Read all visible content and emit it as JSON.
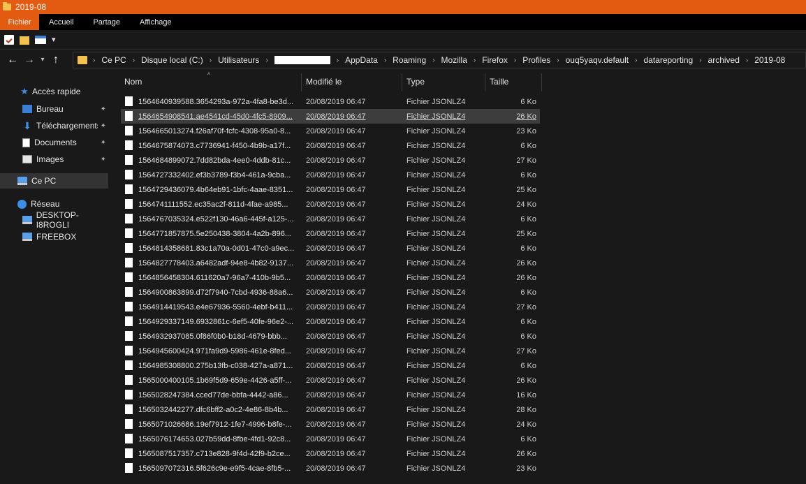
{
  "window": {
    "title": "2019-08"
  },
  "ribbon_tabs": [
    "Fichier",
    "Accueil",
    "Partage",
    "Affichage"
  ],
  "quick_access": {
    "dropdown": "▾"
  },
  "address_bar": {
    "crumbs": [
      "Ce PC",
      "Disque local (C:)",
      "Utilisateurs",
      "AppData",
      "Roaming",
      "Mozilla",
      "Firefox",
      "Profiles",
      "ouq5yaqv.default",
      "datareporting",
      "archived",
      "2019-08"
    ]
  },
  "nav_pane": {
    "quick_access": "Accès rapide",
    "pinned": [
      "Bureau",
      "Téléchargements",
      "Documents",
      "Images"
    ],
    "this_pc": "Ce PC",
    "network": "Réseau",
    "network_items": [
      "DESKTOP-I8ROGLI",
      "FREEBOX"
    ]
  },
  "columns": {
    "name": "Nom",
    "modified": "Modifié le",
    "type": "Type",
    "size": "Taille"
  },
  "files": [
    {
      "name": "1564640939588.3654293a-972a-4fa8-be3d...",
      "date": "20/08/2019 06:47",
      "type": "Fichier JSONLZ4",
      "size": "6 Ko"
    },
    {
      "name": "1564654908541.ae4541cd-45d0-4fc5-8909...",
      "date": "20/08/2019 06:47",
      "type": "Fichier JSONLZ4",
      "size": "26 Ko"
    },
    {
      "name": "1564665013274.f26af70f-fcfc-4308-95a0-8...",
      "date": "20/08/2019 06:47",
      "type": "Fichier JSONLZ4",
      "size": "23 Ko"
    },
    {
      "name": "1564675874073.c7736941-f450-4b9b-a17f...",
      "date": "20/08/2019 06:47",
      "type": "Fichier JSONLZ4",
      "size": "6 Ko"
    },
    {
      "name": "1564684899072.7dd82bda-4ee0-4ddb-81c...",
      "date": "20/08/2019 06:47",
      "type": "Fichier JSONLZ4",
      "size": "27 Ko"
    },
    {
      "name": "1564727332402.ef3b3789-f3b4-461a-9cba...",
      "date": "20/08/2019 06:47",
      "type": "Fichier JSONLZ4",
      "size": "6 Ko"
    },
    {
      "name": "1564729436079.4b64eb91-1bfc-4aae-8351...",
      "date": "20/08/2019 06:47",
      "type": "Fichier JSONLZ4",
      "size": "25 Ko"
    },
    {
      "name": "1564741111552.ec35ac2f-811d-4fae-a985...",
      "date": "20/08/2019 06:47",
      "type": "Fichier JSONLZ4",
      "size": "24 Ko"
    },
    {
      "name": "1564767035324.e522f130-46a6-445f-a125-...",
      "date": "20/08/2019 06:47",
      "type": "Fichier JSONLZ4",
      "size": "6 Ko"
    },
    {
      "name": "1564771857875.5e250438-3804-4a2b-896...",
      "date": "20/08/2019 06:47",
      "type": "Fichier JSONLZ4",
      "size": "25 Ko"
    },
    {
      "name": "1564814358681.83c1a70a-0d01-47c0-a9ec...",
      "date": "20/08/2019 06:47",
      "type": "Fichier JSONLZ4",
      "size": "6 Ko"
    },
    {
      "name": "1564827778403.a6482adf-94e8-4b82-9137...",
      "date": "20/08/2019 06:47",
      "type": "Fichier JSONLZ4",
      "size": "26 Ko"
    },
    {
      "name": "1564856458304.611620a7-96a7-410b-9b5...",
      "date": "20/08/2019 06:47",
      "type": "Fichier JSONLZ4",
      "size": "26 Ko"
    },
    {
      "name": "1564900863899.d72f7940-7cbd-4936-88a6...",
      "date": "20/08/2019 06:47",
      "type": "Fichier JSONLZ4",
      "size": "6 Ko"
    },
    {
      "name": "1564914419543.e4e67936-5560-4ebf-b411...",
      "date": "20/08/2019 06:47",
      "type": "Fichier JSONLZ4",
      "size": "27 Ko"
    },
    {
      "name": "1564929337149.6932861c-6ef5-40fe-96e2-...",
      "date": "20/08/2019 06:47",
      "type": "Fichier JSONLZ4",
      "size": "6 Ko"
    },
    {
      "name": "1564932937085.0f86f0b0-b18d-4679-bbb...",
      "date": "20/08/2019 06:47",
      "type": "Fichier JSONLZ4",
      "size": "6 Ko"
    },
    {
      "name": "1564945600424.971fa9d9-5986-461e-8fed...",
      "date": "20/08/2019 06:47",
      "type": "Fichier JSONLZ4",
      "size": "27 Ko"
    },
    {
      "name": "1564985308800.275b13fb-c038-427a-a871...",
      "date": "20/08/2019 06:47",
      "type": "Fichier JSONLZ4",
      "size": "6 Ko"
    },
    {
      "name": "1565000400105.1b69f5d9-659e-4426-a5ff-...",
      "date": "20/08/2019 06:47",
      "type": "Fichier JSONLZ4",
      "size": "26 Ko"
    },
    {
      "name": "1565028247384.cced77de-bbfa-4442-a86...",
      "date": "20/08/2019 06:47",
      "type": "Fichier JSONLZ4",
      "size": "16 Ko"
    },
    {
      "name": "1565032442277.dfc6bff2-a0c2-4e86-8b4b...",
      "date": "20/08/2019 06:47",
      "type": "Fichier JSONLZ4",
      "size": "28 Ko"
    },
    {
      "name": "1565071026686.19ef7912-1fe7-4996-b8fe-...",
      "date": "20/08/2019 06:47",
      "type": "Fichier JSONLZ4",
      "size": "24 Ko"
    },
    {
      "name": "1565076174653.027b59dd-8fbe-4fd1-92c8...",
      "date": "20/08/2019 06:47",
      "type": "Fichier JSONLZ4",
      "size": "6 Ko"
    },
    {
      "name": "1565087517357.c713e828-9f4d-42f9-b2ce...",
      "date": "20/08/2019 06:47",
      "type": "Fichier JSONLZ4",
      "size": "26 Ko"
    },
    {
      "name": "1565097072316.5f626c9e-e9f5-4cae-8fb5-...",
      "date": "20/08/2019 06:47",
      "type": "Fichier JSONLZ4",
      "size": "23 Ko"
    }
  ]
}
